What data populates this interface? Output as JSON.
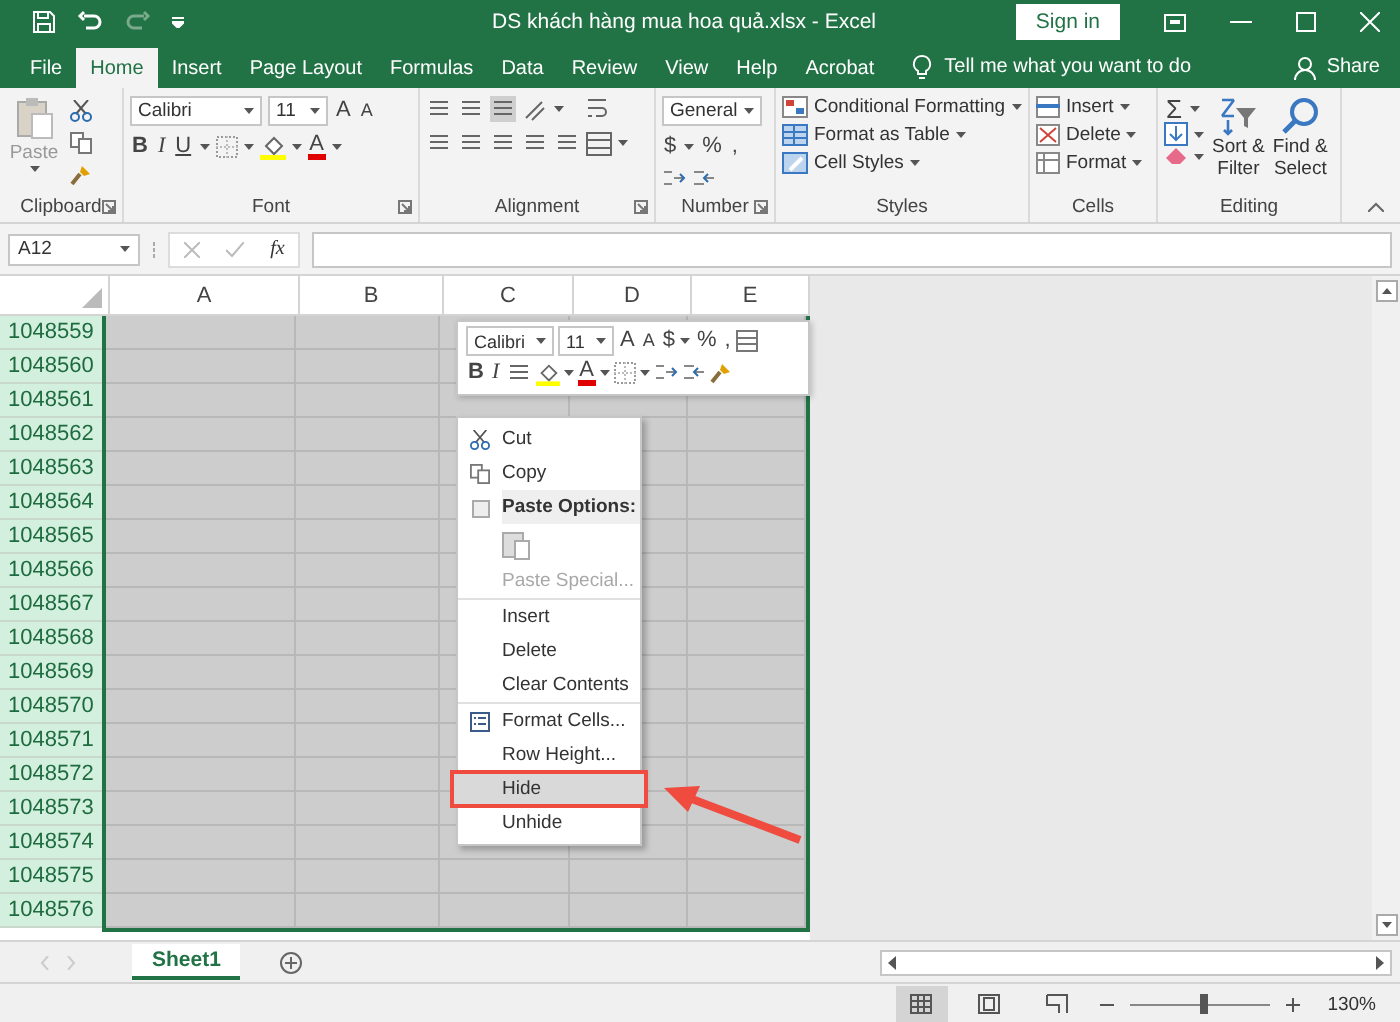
{
  "window": {
    "title": "DS khách hàng mua hoa quả.xlsx  -  Excel",
    "sign_in": "Sign in"
  },
  "tabs": [
    {
      "label": "File",
      "selected": false
    },
    {
      "label": "Home",
      "selected": true
    },
    {
      "label": "Insert",
      "selected": false
    },
    {
      "label": "Page Layout",
      "selected": false
    },
    {
      "label": "Formulas",
      "selected": false
    },
    {
      "label": "Data",
      "selected": false
    },
    {
      "label": "Review",
      "selected": false
    },
    {
      "label": "View",
      "selected": false
    },
    {
      "label": "Help",
      "selected": false
    },
    {
      "label": "Acrobat",
      "selected": false
    }
  ],
  "tell_me": "Tell me what you want to do",
  "share": "Share",
  "ribbon": {
    "clipboard": {
      "label": "Clipboard",
      "paste": "Paste"
    },
    "font": {
      "label": "Font",
      "font_name": "Calibri",
      "font_size": "11",
      "grow": "A",
      "shrink": "A",
      "bold": "B",
      "italic": "I",
      "underline": "U",
      "font_color": "A"
    },
    "alignment": {
      "label": "Alignment"
    },
    "number": {
      "label": "Number",
      "format": "General",
      "currency": "$",
      "percent": "%",
      "comma": ","
    },
    "styles": {
      "label": "Styles",
      "items": [
        "Conditional Formatting",
        "Format as Table",
        "Cell Styles"
      ]
    },
    "cells": {
      "label": "Cells",
      "items": [
        "Insert",
        "Delete",
        "Format"
      ]
    },
    "editing": {
      "label": "Editing",
      "autosum": "Σ",
      "sort": [
        "Sort &",
        "Filter"
      ],
      "find": [
        "Find &",
        "Select"
      ]
    }
  },
  "formula_bar": {
    "name_box": "A12",
    "fx": "fx"
  },
  "columns": [
    "A",
    "B",
    "C",
    "D",
    "E"
  ],
  "rows": [
    {
      "label": "1048559",
      "selected": true
    },
    {
      "label": "1048560",
      "selected": true
    },
    {
      "label": "1048561",
      "selected": true
    },
    {
      "label": "1048562",
      "selected": true
    },
    {
      "label": "1048563",
      "selected": true
    },
    {
      "label": "1048564",
      "selected": true
    },
    {
      "label": "1048565",
      "selected": true
    },
    {
      "label": "1048566",
      "selected": true
    },
    {
      "label": "1048567",
      "selected": true
    },
    {
      "label": "1048568",
      "selected": true
    },
    {
      "label": "1048569",
      "selected": true
    },
    {
      "label": "1048570",
      "selected": true
    },
    {
      "label": "1048571",
      "selected": true
    },
    {
      "label": "1048572",
      "selected": true
    },
    {
      "label": "1048573",
      "selected": true
    },
    {
      "label": "1048574",
      "selected": true
    },
    {
      "label": "1048575",
      "selected": true
    },
    {
      "label": "1048576",
      "selected": true
    }
  ],
  "mini_toolbar": {
    "font_name": "Calibri",
    "font_size": "11",
    "grow": "A",
    "shrink": "A",
    "currency": "$",
    "percent": "%",
    "comma": ",",
    "bold": "B",
    "italic": "I",
    "font_color": "A"
  },
  "context_menu": [
    {
      "kind": "cut",
      "label": "Cut",
      "disabled": false,
      "selected": false,
      "separator_after": false
    },
    {
      "kind": "copy",
      "label": "Copy",
      "disabled": false,
      "selected": false,
      "separator_after": false
    },
    {
      "kind": "paste-options",
      "label": "Paste Options:",
      "disabled": false,
      "selected": false,
      "separator_after": false
    },
    {
      "kind": "paste",
      "disabled": false,
      "selected": false,
      "separator_after": false
    },
    {
      "kind": "command",
      "label": "Paste Special...",
      "disabled": true,
      "selected": false,
      "separator_after": true
    },
    {
      "kind": "command",
      "label": "Insert",
      "disabled": false,
      "selected": false,
      "separator_after": false
    },
    {
      "kind": "command",
      "label": "Delete",
      "disabled": false,
      "selected": false,
      "separator_after": false
    },
    {
      "kind": "command",
      "label": "Clear Contents",
      "disabled": false,
      "selected": false,
      "separator_after": true
    },
    {
      "kind": "format-cells",
      "label": "Format Cells...",
      "disabled": false,
      "selected": false,
      "separator_after": false
    },
    {
      "kind": "command",
      "label": "Row Height...",
      "disabled": false,
      "selected": false,
      "separator_after": false
    },
    {
      "kind": "command",
      "label": "Hide",
      "disabled": false,
      "selected": true,
      "separator_after": false
    },
    {
      "kind": "command",
      "label": "Unhide",
      "disabled": false,
      "selected": false,
      "separator_after": false
    }
  ],
  "sheets": [
    {
      "label": "Sheet1",
      "selected": true
    }
  ],
  "status_bar": {
    "views": [
      {
        "kind": "normal",
        "selected": true
      },
      {
        "kind": "page-layout",
        "selected": false
      },
      {
        "kind": "page-break",
        "selected": false
      }
    ],
    "zoom_slider": {
      "level": 0.54
    },
    "zoom": "130%"
  }
}
